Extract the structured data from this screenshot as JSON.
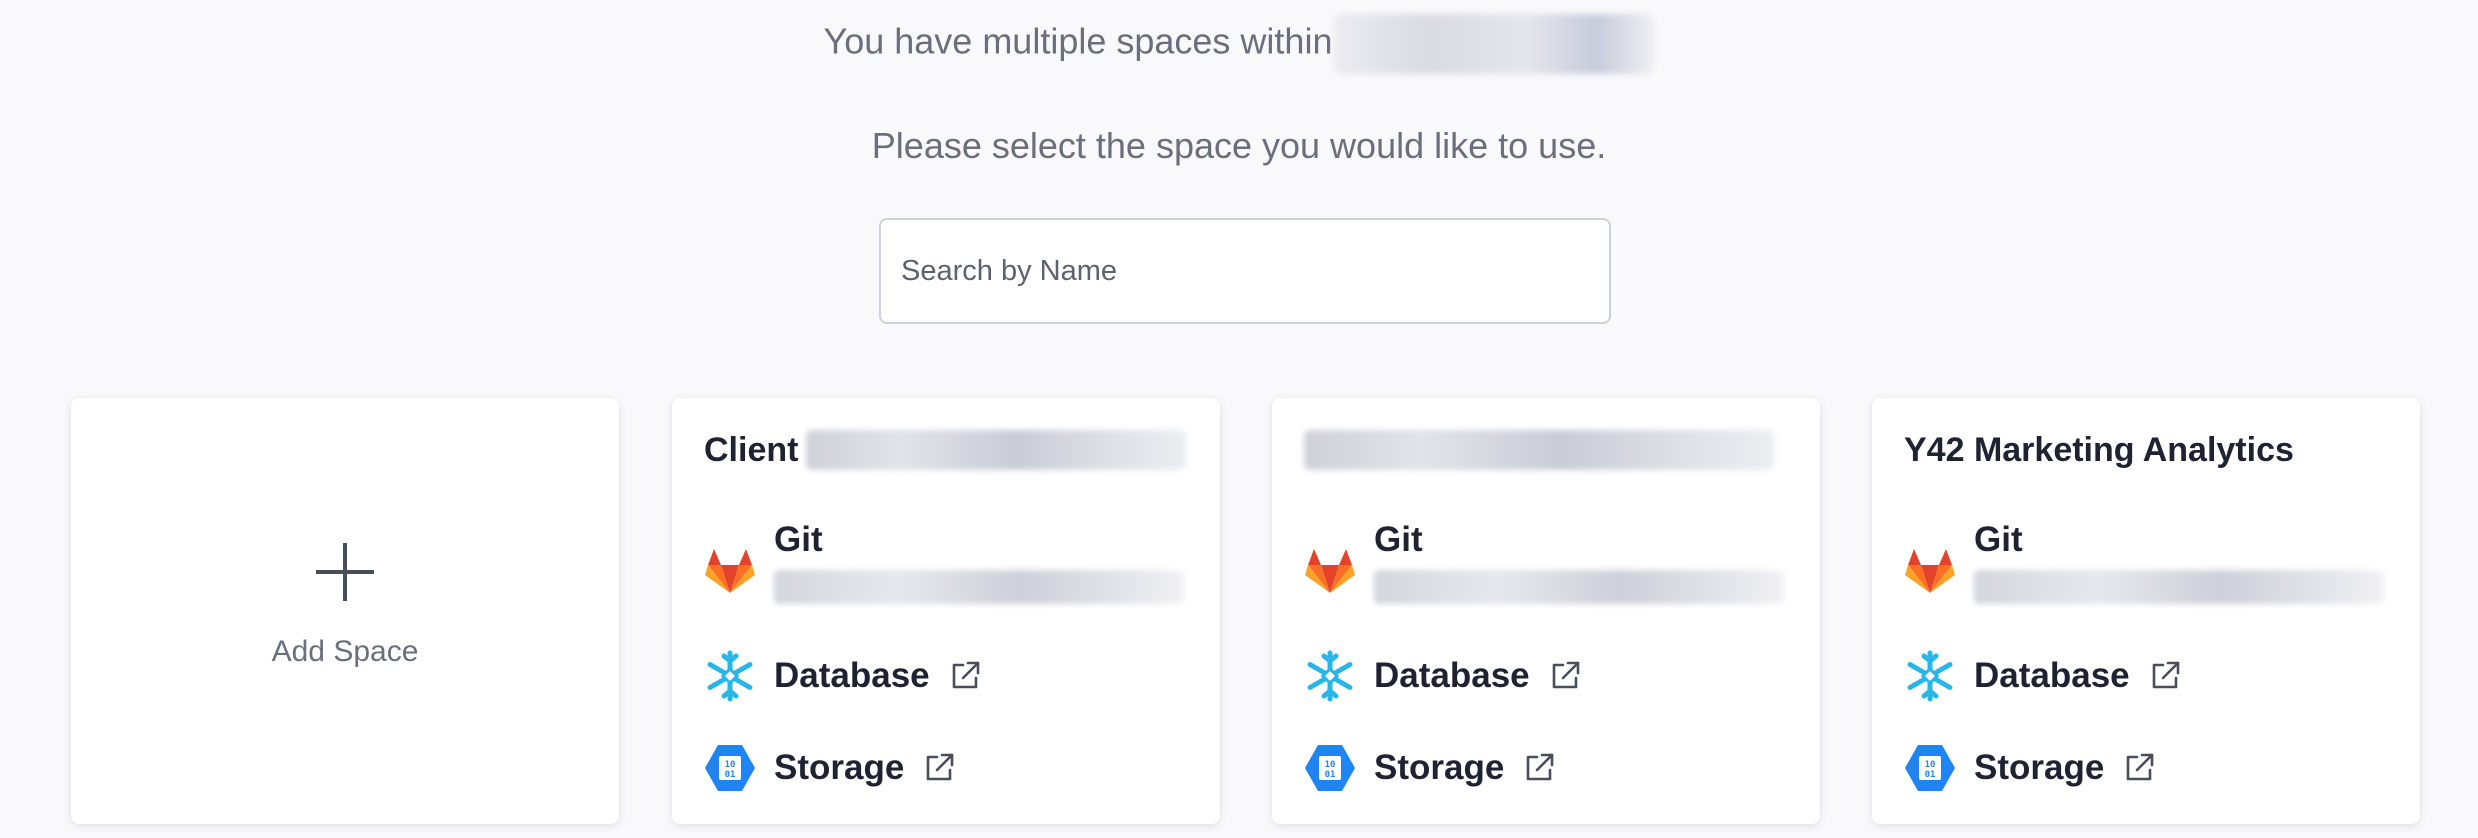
{
  "header": {
    "line1": "You have multiple spaces within",
    "line2": "Please select the space you would like to use."
  },
  "search": {
    "placeholder": "Search by Name",
    "value": ""
  },
  "add_space": {
    "label": "Add Space"
  },
  "spaces": [
    {
      "title": "Client",
      "git_label": "Git",
      "database_label": "Database",
      "storage_label": "Storage"
    },
    {
      "title": "",
      "git_label": "Git",
      "database_label": "Database",
      "storage_label": "Storage"
    },
    {
      "title": "Y42 Marketing Analytics",
      "git_label": "Git",
      "database_label": "Database",
      "storage_label": "Storage"
    }
  ],
  "icons": {
    "git": "gitlab-icon",
    "database": "snowflake-icon",
    "storage": "azure-storage-icon",
    "external": "external-link-icon",
    "add": "plus-icon"
  },
  "colors": {
    "background": "#f9f8fb",
    "text_primary": "#1f2230",
    "text_muted": "#6b6f7b",
    "gitlab_orange": "#fc6d26",
    "snowflake_blue": "#29b5e8",
    "azure_blue": "#1f85f2"
  }
}
